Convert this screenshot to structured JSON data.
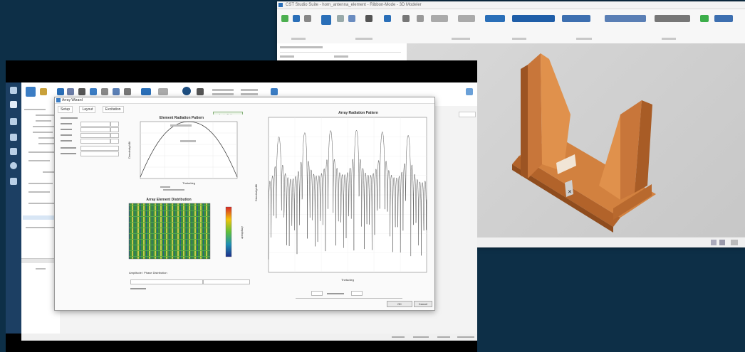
{
  "cad_window": {
    "title": "CST Studio Suite - horn_antenna_element - Ribbon-Mode - 3D Modeler"
  },
  "front_window": {
    "dialog": {
      "title": "Array Wizard",
      "tabs": [
        "Setup",
        "Layout",
        "Excitation"
      ],
      "apply_label": "Apply Settings",
      "ok_label": "OK",
      "cancel_label": "Cancel",
      "excitation_label": "Amplitude / Phase Distribution"
    },
    "element_chart": {
      "title": "Element Radiation Pattern",
      "xlabel": "Theta/deg",
      "ylabel": "Directivity/dBi"
    },
    "array_chart": {
      "title": "Array Radiation Pattern",
      "xlabel": "Theta/deg",
      "ylabel": "Directivity/dBi"
    },
    "heatmap": {
      "title": "Array Element Distribution",
      "colorbar_label": "Amplitude"
    }
  },
  "colors": {
    "background": "#0d2f47",
    "model_orange": "#d2813f",
    "sidebar": "#1c3f63",
    "accent_blue": "#3b7dc4"
  }
}
